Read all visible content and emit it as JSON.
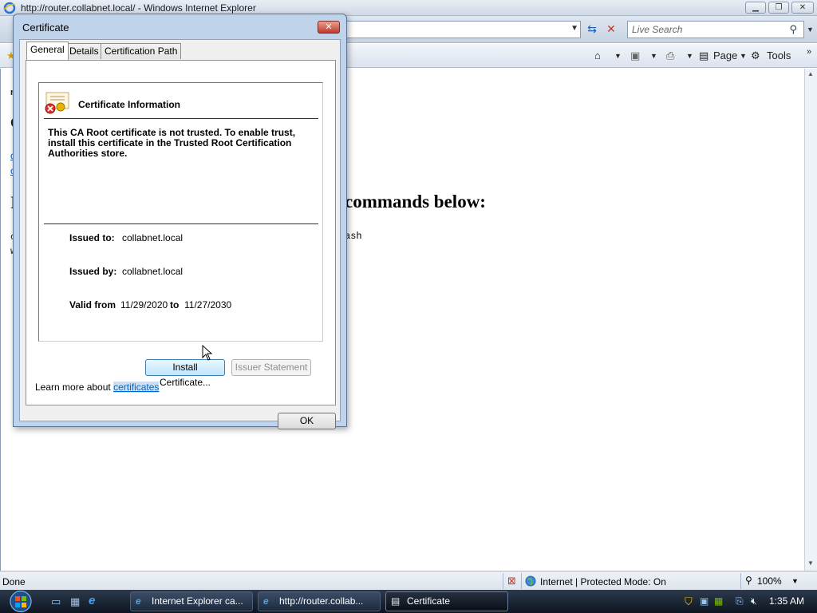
{
  "browser": {
    "window_title": "http://router.collabnet.local/ - Windows Internet Explorer",
    "search_placeholder": "Live Search",
    "command_bar": {
      "page_label": "Page",
      "tools_label": "Tools"
    },
    "page": {
      "heading": "commands below:",
      "code_fragment": "ash"
    },
    "status": {
      "text": "Done",
      "zone": "Internet | Protected Mode: On",
      "zoom": "100%"
    }
  },
  "taskbar": {
    "buttons": [
      {
        "label": "Internet Explorer ca...",
        "active": false
      },
      {
        "label": "http://router.collab...",
        "active": false
      },
      {
        "label": "Certificate",
        "active": true
      }
    ],
    "clock": "1:35 AM"
  },
  "dialog": {
    "title": "Certificate",
    "close_label": "✕",
    "tabs": [
      "General",
      "Details",
      "Certification Path"
    ],
    "selected_tab": "General",
    "info_title": "Certificate Information",
    "warning": "This CA Root certificate is not trusted. To enable trust, install this certificate in the Trusted Root Certification Authorities store.",
    "issued_to_label": "Issued to:",
    "issued_to": "collabnet.local",
    "issued_by_label": "Issued by:",
    "issued_by": "collabnet.local",
    "valid_from_label": "Valid from",
    "valid_from": "11/29/2020",
    "valid_to_label": "to",
    "valid_to": "11/27/2030",
    "install_button": "Install Certificate...",
    "issuer_button": "Issuer Statement",
    "learn_more_prefix": "Learn more about",
    "learn_more_link": "certificates",
    "ok_button": "OK"
  },
  "colors": {
    "link": "#0066cc",
    "dialog_frame": "#bfd3ea",
    "taskbar": "#1c2a3d"
  }
}
